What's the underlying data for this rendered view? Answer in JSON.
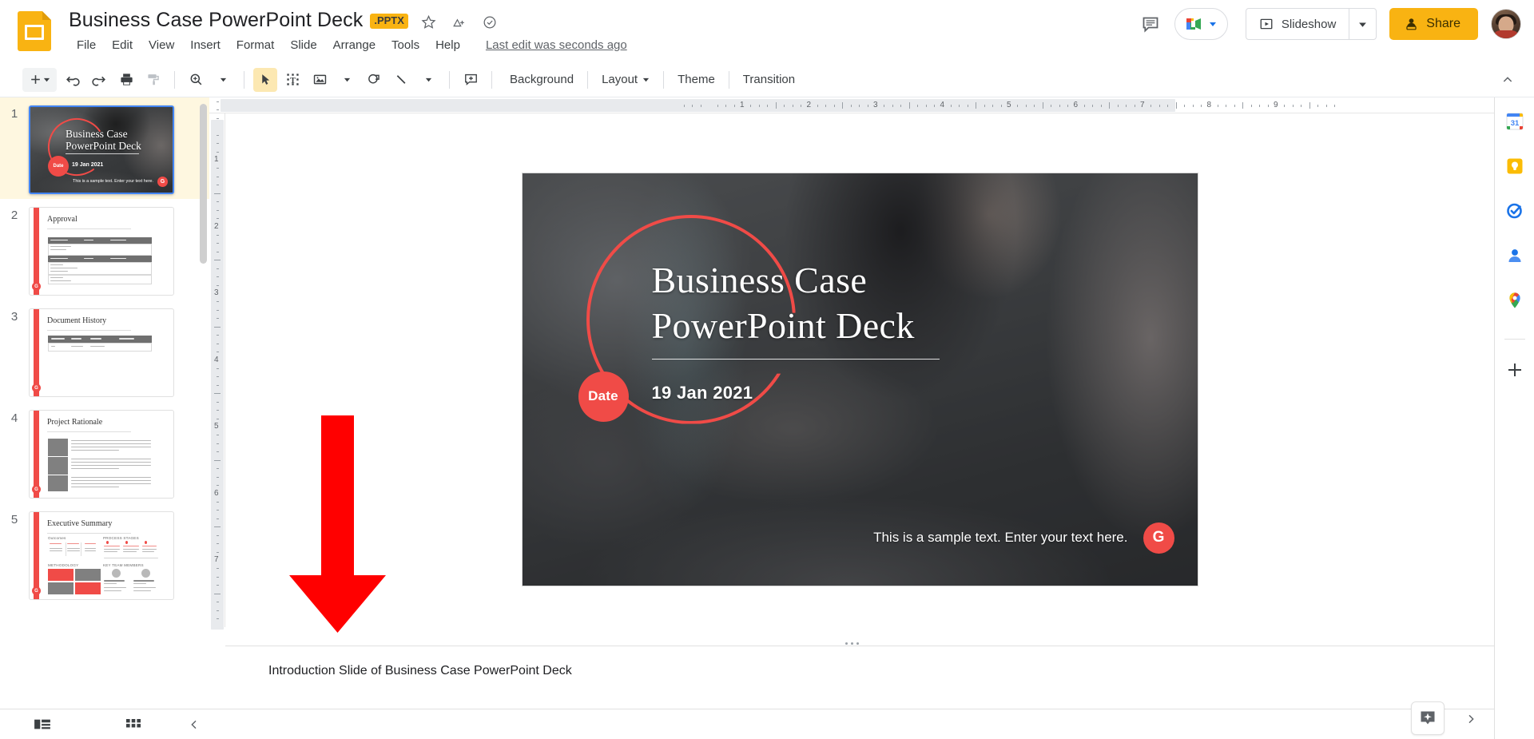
{
  "app": {
    "name": "Google Slides"
  },
  "header": {
    "doc_title": "Business Case  PowerPoint Deck",
    "file_type_badge": ".PPTX",
    "star_icon": "star-icon",
    "drive_move_icon": "move-to-drive-icon",
    "cloud_status_icon": "cloud-saved-icon",
    "last_edit": "Last edit was seconds ago",
    "menus": [
      "File",
      "Edit",
      "View",
      "Insert",
      "Format",
      "Slide",
      "Arrange",
      "Tools",
      "Help"
    ],
    "comment_icon": "comment-history-icon",
    "meet_label": "",
    "slideshow_label": "Slideshow",
    "share_label": "Share",
    "avatar_label": "account-avatar"
  },
  "toolbar": {
    "new_slide": "+",
    "undo": "undo-icon",
    "redo": "redo-icon",
    "print": "print-icon",
    "paint_format": "paint-format-icon",
    "zoom": "zoom-icon",
    "select": "select-cursor-icon",
    "textbox": "text-box-icon",
    "image": "insert-image-icon",
    "shape": "shape-icon",
    "line": "line-icon",
    "comment": "add-comment-icon",
    "background_label": "Background",
    "layout_label": "Layout",
    "theme_label": "Theme",
    "transition_label": "Transition",
    "collapse_icon": "collapse-toolbar-icon"
  },
  "filmstrip": {
    "slides": [
      {
        "number": "1",
        "title": "Business Case PowerPoint Deck",
        "selected": true,
        "date_label": "Date",
        "date_value": "19 Jan 2021",
        "footer_text": "This is a sample text. Enter your text here.",
        "badge": "G"
      },
      {
        "number": "2",
        "title": "Approval",
        "selected": false,
        "badge": "G"
      },
      {
        "number": "3",
        "title": "Document History",
        "selected": false,
        "badge": "G"
      },
      {
        "number": "4",
        "title": "Project Rationale",
        "selected": false,
        "badge": "G"
      },
      {
        "number": "5",
        "title": "Executive Summary",
        "selected": false,
        "badge": "G"
      }
    ],
    "slide3_columns": [
      "Version",
      "Date",
      "Author",
      "Comments"
    ],
    "slide5_sections": [
      "Outcomes",
      "PROCESS STAGES",
      "METHODOLOGY",
      "KEY TEAM MEMBERS"
    ]
  },
  "ruler": {
    "horizontal_labels": [
      "1",
      "2",
      "3",
      "4",
      "5",
      "6",
      "7",
      "8",
      "9"
    ],
    "vertical_labels": [
      "1",
      "2",
      "3",
      "4",
      "5",
      "6",
      "7"
    ]
  },
  "slide": {
    "title_line1": "Business Case",
    "title_line2": "PowerPoint Deck",
    "date_chip": "Date",
    "date_value": "19 Jan 2021",
    "bottom_text": "This is a sample text. Enter your text here.",
    "badge": "G",
    "accent_color": "#F04B47"
  },
  "notes": {
    "text": "Introduction Slide of Business Case PowerPoint Deck"
  },
  "bottombar": {
    "filmstrip_view_icon": "filmstrip-view-icon",
    "grid_view_icon": "grid-view-icon",
    "collapse_panel_icon": "collapse-panel-icon",
    "explore_icon": "explore-icon",
    "expand_icon": "expand-side-panel-icon"
  },
  "rail": {
    "items": [
      {
        "name": "google-calendar-icon",
        "label": "31"
      },
      {
        "name": "google-keep-icon",
        "label": ""
      },
      {
        "name": "google-tasks-icon",
        "label": ""
      },
      {
        "name": "google-contacts-icon",
        "label": ""
      },
      {
        "name": "google-maps-icon",
        "label": ""
      }
    ],
    "add_on_icon": "add-ons-plus-icon"
  },
  "colors": {
    "brand_yellow": "#F9B312",
    "accent_red": "#F04B47",
    "annotation_red": "#FF0000",
    "selected_slide_bg": "#FEF7E0"
  }
}
